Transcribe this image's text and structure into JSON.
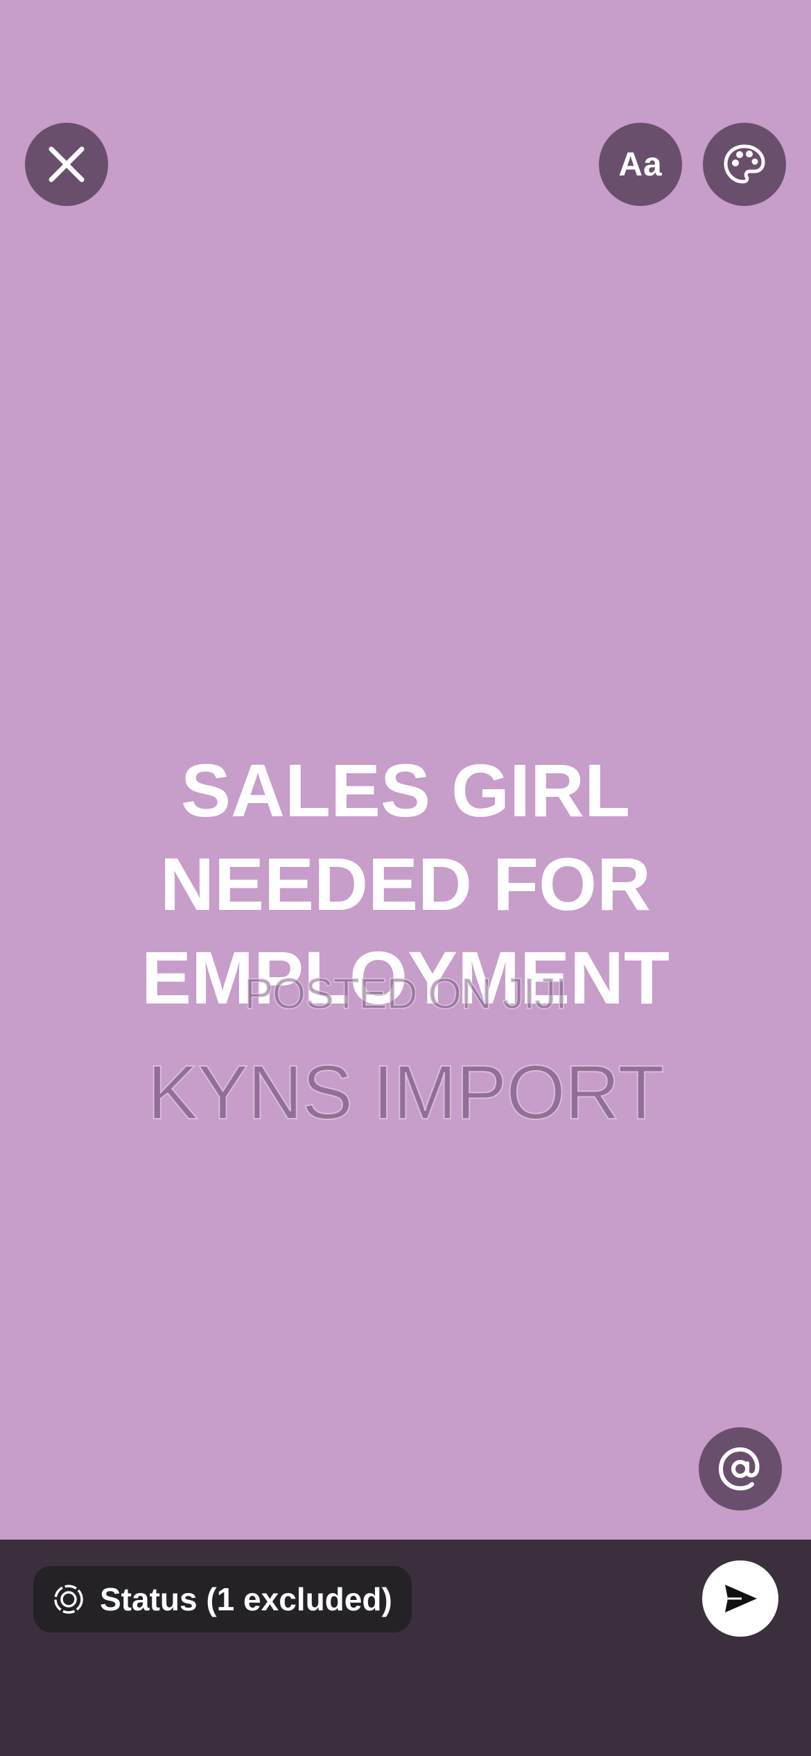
{
  "colors": {
    "background": "#c79dca",
    "button_bg": "#6a4f6d",
    "bottom_bar": "#3b2f3e",
    "pill_bg": "#242226",
    "text": "#ffffff"
  },
  "toolbar": {
    "close_icon": "close-icon",
    "font_button_label": "Aa",
    "palette_icon": "palette-icon"
  },
  "status_post": {
    "text": "SALES GIRL\nNEEDED FOR\nEMPLOYMENT"
  },
  "watermark": {
    "line1": "POSTED ON JIJI",
    "line2": "KYNS IMPORT"
  },
  "mention": {
    "icon": "at-icon",
    "symbol": "@"
  },
  "bottom_bar": {
    "audience_icon": "status-ring-icon",
    "audience_label": "Status (1 excluded)",
    "send_icon": "send-icon"
  }
}
